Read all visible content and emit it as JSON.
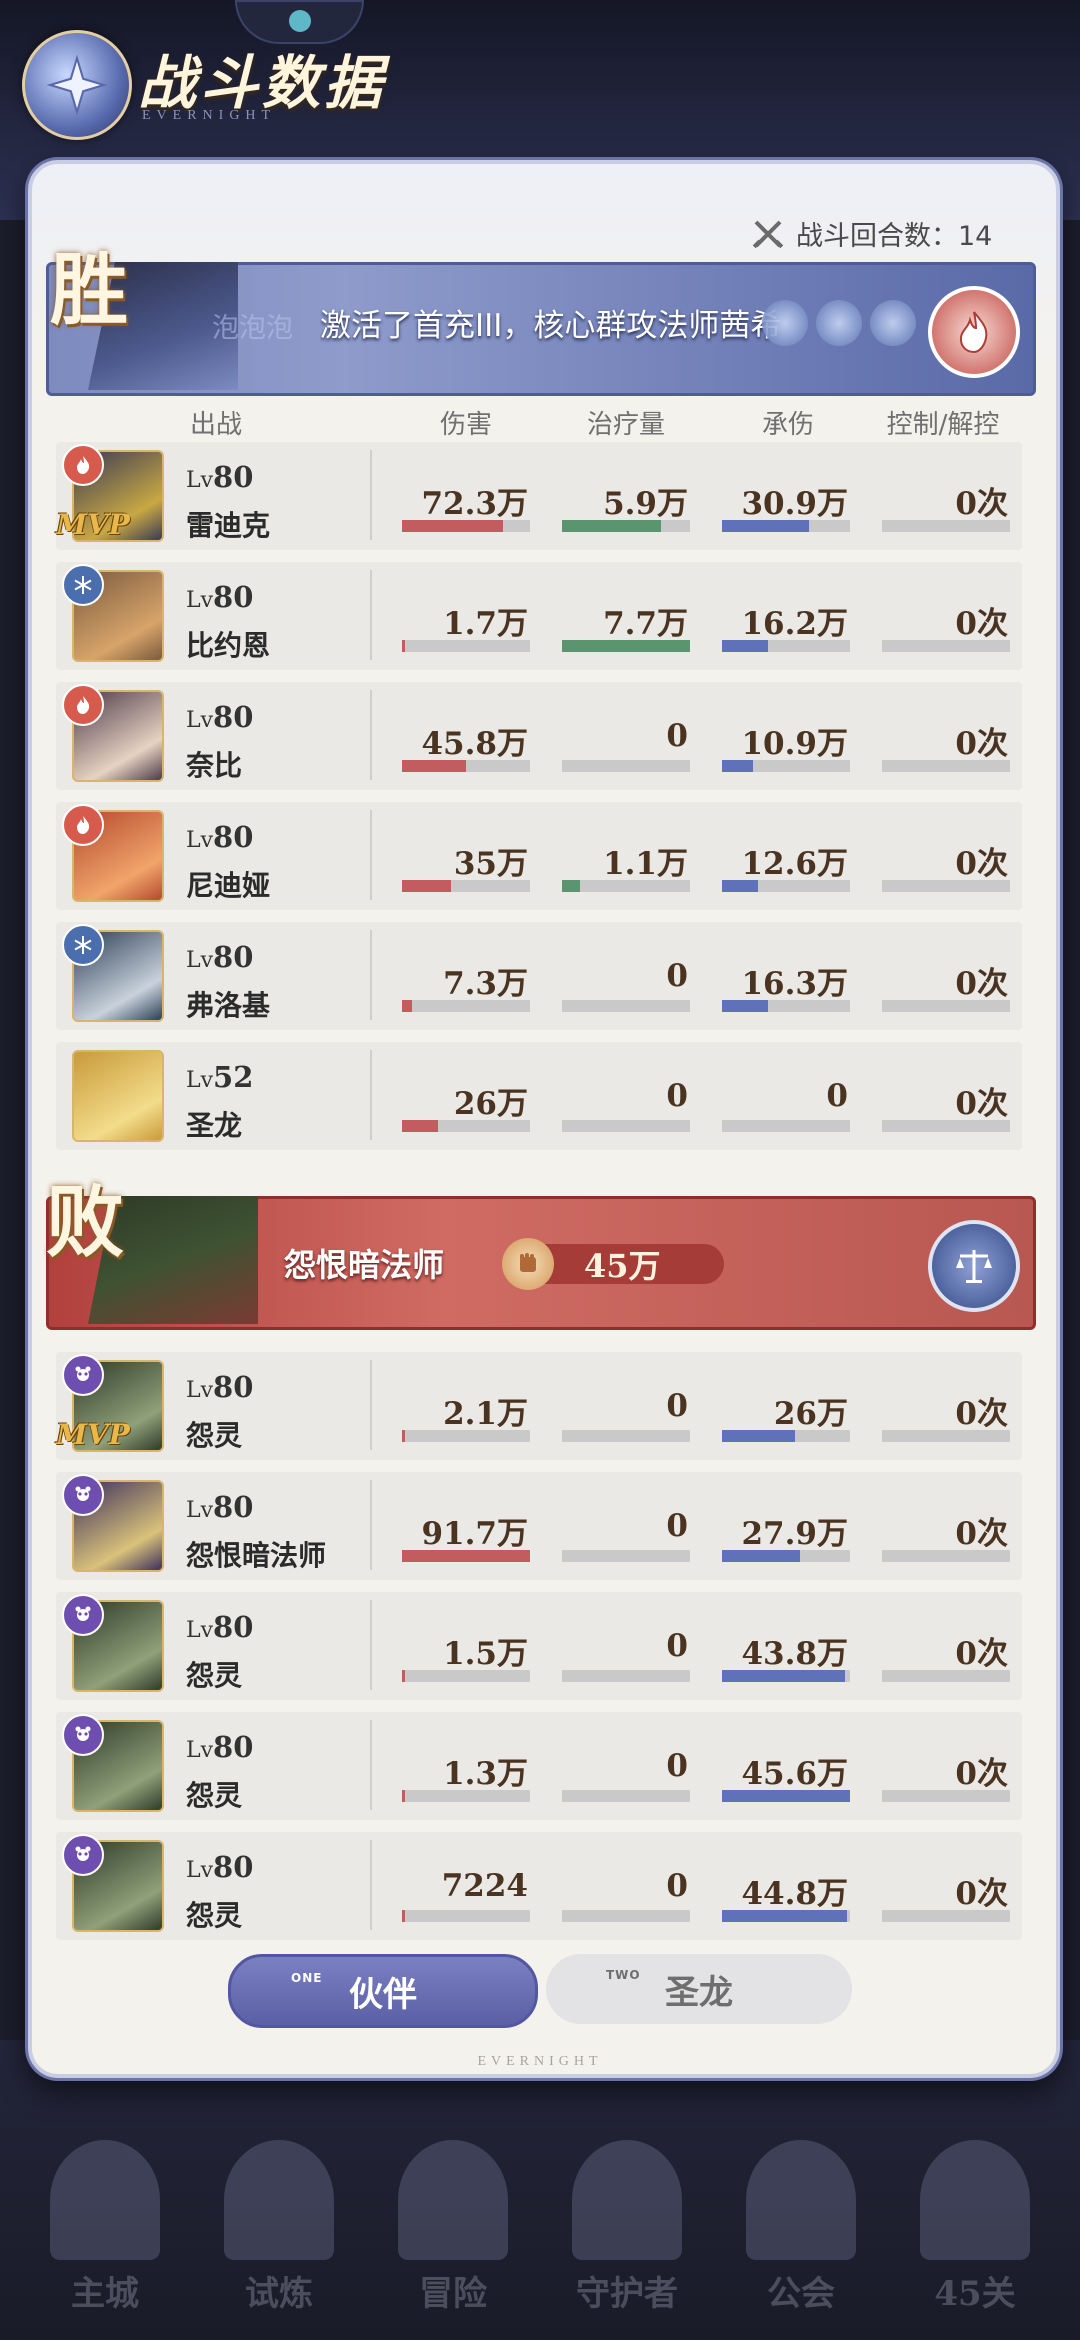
{
  "header": {
    "title": "战斗数据",
    "subtitle": "EVERNIGHT",
    "rounds_label": "战斗回合数：14"
  },
  "win_team": {
    "result": "胜",
    "ghost_text": "泡泡泡",
    "marquee": "激活了首充III，核心群攻法师茜希",
    "element": "pyro"
  },
  "lose_team": {
    "result": "败",
    "boss_name": "怨恨暗法师",
    "power": "45万",
    "element": "balance"
  },
  "columns": [
    "出战",
    "伤害",
    "治疗量",
    "承伤",
    "控制/解控"
  ],
  "win_rows": [
    {
      "level": "80",
      "name": "雷迪克",
      "mvp": true,
      "element": "pyro",
      "avatar_colors": [
        "#3a3a54",
        "#c8a843"
      ],
      "damage": "72.3万",
      "heal": "5.9万",
      "taken": "30.9万",
      "control": "0次",
      "dmg_ratio": 0.79,
      "heal_ratio": 0.77,
      "taken_ratio": 0.68,
      "ctrl_ratio": 0
    },
    {
      "level": "80",
      "name": "比约恩",
      "mvp": false,
      "element": "cryo",
      "avatar_colors": [
        "#7a5a3e",
        "#d7a46a"
      ],
      "damage": "1.7万",
      "heal": "7.7万",
      "taken": "16.2万",
      "control": "0次",
      "dmg_ratio": 0.02,
      "heal_ratio": 1.0,
      "taken_ratio": 0.36,
      "ctrl_ratio": 0
    },
    {
      "level": "80",
      "name": "奈比",
      "mvp": false,
      "element": "pyro",
      "avatar_colors": [
        "#4b3a48",
        "#e7d2c2"
      ],
      "damage": "45.8万",
      "heal": "0",
      "taken": "10.9万",
      "control": "0次",
      "dmg_ratio": 0.5,
      "heal_ratio": 0,
      "taken_ratio": 0.24,
      "ctrl_ratio": 0
    },
    {
      "level": "80",
      "name": "尼迪娅",
      "mvp": false,
      "element": "pyro",
      "avatar_colors": [
        "#b4492e",
        "#f1a46a"
      ],
      "damage": "35万",
      "heal": "1.1万",
      "taken": "12.6万",
      "control": "0次",
      "dmg_ratio": 0.38,
      "heal_ratio": 0.14,
      "taken_ratio": 0.28,
      "ctrl_ratio": 0
    },
    {
      "level": "80",
      "name": "弗洛基",
      "mvp": false,
      "element": "cryo",
      "avatar_colors": [
        "#2c3e55",
        "#c9d2dc"
      ],
      "damage": "7.3万",
      "heal": "0",
      "taken": "16.3万",
      "control": "0次",
      "dmg_ratio": 0.08,
      "heal_ratio": 0,
      "taken_ratio": 0.36,
      "ctrl_ratio": 0
    },
    {
      "level": "52",
      "name": "圣龙",
      "mvp": false,
      "element": "",
      "avatar_colors": [
        "#c99a3a",
        "#f3dc8a"
      ],
      "damage": "26万",
      "heal": "0",
      "taken": "0",
      "control": "0次",
      "dmg_ratio": 0.28,
      "heal_ratio": 0,
      "taken_ratio": 0,
      "ctrl_ratio": 0
    }
  ],
  "lose_rows": [
    {
      "level": "80",
      "name": "怨灵",
      "mvp": true,
      "element": "dark",
      "avatar_colors": [
        "#2d3b28",
        "#8fa07a"
      ],
      "damage": "2.1万",
      "heal": "0",
      "taken": "26万",
      "control": "0次",
      "dmg_ratio": 0.02,
      "heal_ratio": 0,
      "taken_ratio": 0.57,
      "ctrl_ratio": 0
    },
    {
      "level": "80",
      "name": "怨恨暗法师",
      "mvp": false,
      "element": "dark",
      "avatar_colors": [
        "#3c2f5c",
        "#d9c27a"
      ],
      "damage": "91.7万",
      "heal": "0",
      "taken": "27.9万",
      "control": "0次",
      "dmg_ratio": 1.0,
      "heal_ratio": 0,
      "taken_ratio": 0.61,
      "ctrl_ratio": 0
    },
    {
      "level": "80",
      "name": "怨灵",
      "mvp": false,
      "element": "dark",
      "avatar_colors": [
        "#2d3b28",
        "#8fa07a"
      ],
      "damage": "1.5万",
      "heal": "0",
      "taken": "43.8万",
      "control": "0次",
      "dmg_ratio": 0.02,
      "heal_ratio": 0,
      "taken_ratio": 0.96,
      "ctrl_ratio": 0
    },
    {
      "level": "80",
      "name": "怨灵",
      "mvp": false,
      "element": "dark",
      "avatar_colors": [
        "#2d3b28",
        "#8fa07a"
      ],
      "damage": "1.3万",
      "heal": "0",
      "taken": "45.6万",
      "control": "0次",
      "dmg_ratio": 0.01,
      "heal_ratio": 0,
      "taken_ratio": 1.0,
      "ctrl_ratio": 0
    },
    {
      "level": "80",
      "name": "怨灵",
      "mvp": false,
      "element": "dark",
      "avatar_colors": [
        "#2d3b28",
        "#8fa07a"
      ],
      "damage": "7224",
      "heal": "0",
      "taken": "44.8万",
      "control": "0次",
      "dmg_ratio": 0.01,
      "heal_ratio": 0,
      "taken_ratio": 0.98,
      "ctrl_ratio": 0
    }
  ],
  "tabs": [
    {
      "num": "ONE",
      "label": "伙伴",
      "active": true
    },
    {
      "num": "TWO",
      "label": "圣龙",
      "active": false
    }
  ],
  "footer": "EVERNIGHT",
  "bottom_nav": [
    "主城",
    "试炼",
    "冒险",
    "守护者",
    "公会",
    "45关"
  ],
  "colors": {
    "damage": "#c35c5f",
    "heal": "#5b9570",
    "taken": "#5f72b9",
    "win_banner": "#7d8bbe",
    "lose_banner": "#c45e57"
  }
}
